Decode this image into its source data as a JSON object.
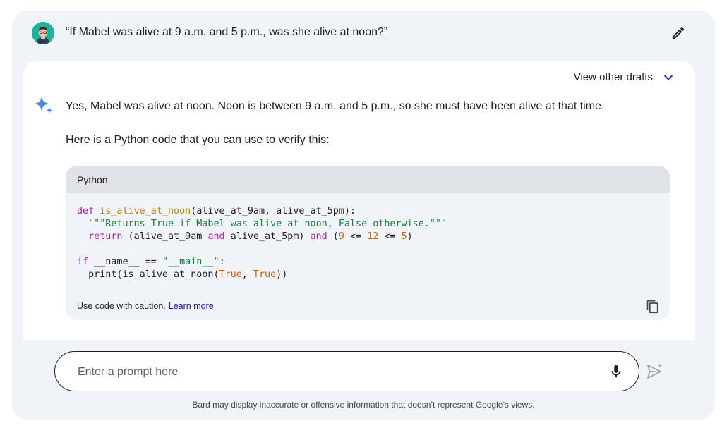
{
  "prompt": {
    "text": "“If Mabel was alive at 9 a.m. and 5 p.m., was she alive at noon?”"
  },
  "response": {
    "drafts_label": "View other drafts",
    "line1": "Yes, Mabel was alive at noon. Noon is between 9 a.m. and 5 p.m., so she must have been alive at that time.",
    "line2": "Here is a Python code that you can use to verify this:",
    "code": {
      "language": "Python",
      "caution": "Use code with caution.",
      "learn_more": "Learn more"
    }
  },
  "input": {
    "placeholder": "Enter a prompt here"
  },
  "disclaimer": "Bard may display inaccurate or offensive information that doesn’t represent Google’s views.",
  "colors": {
    "panel": "#f0f4f9",
    "code_header": "#dfe3e7",
    "accent": "#4b32c3"
  },
  "icons": [
    "avatar",
    "pencil-icon",
    "chevron-down-icon",
    "sparkle-icon",
    "copy-icon",
    "mic-icon",
    "send-icon"
  ]
}
